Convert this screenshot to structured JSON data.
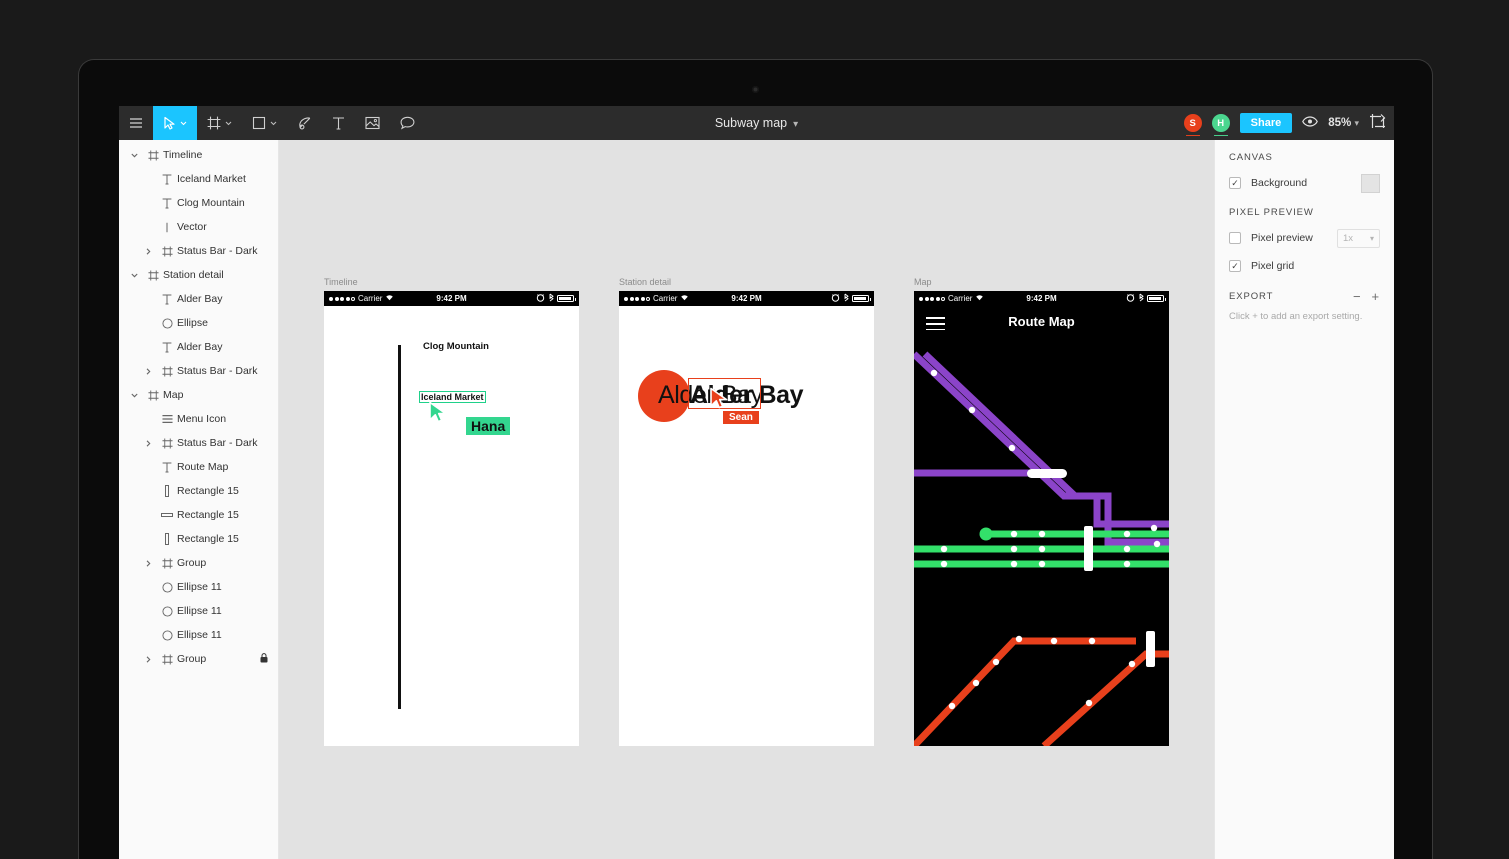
{
  "app": {
    "file_title": "Subway map",
    "zoom_level": "85%",
    "share_label": "Share",
    "avatars": [
      {
        "initial": "S",
        "color": "#e8401c"
      },
      {
        "initial": "H",
        "color": "#4bd68f"
      }
    ],
    "toolbar_icons": [
      "menu-icon",
      "move-tool-icon",
      "frame-tool-icon",
      "shape-tool-icon",
      "pen-tool-icon",
      "text-tool-icon",
      "image-tool-icon",
      "comment-tool-icon"
    ],
    "accent_color": "#1bc5ff"
  },
  "layers": {
    "items": [
      {
        "label": "Timeline",
        "icon": "frame-icon",
        "indent": 0,
        "disclosure": "down",
        "locked": false
      },
      {
        "label": "Iceland Market",
        "icon": "text-icon",
        "indent": 1,
        "disclosure": "none",
        "locked": false
      },
      {
        "label": "Clog Mountain",
        "icon": "text-icon",
        "indent": 1,
        "disclosure": "none",
        "locked": false
      },
      {
        "label": "Vector",
        "icon": "vector-icon",
        "indent": 1,
        "disclosure": "none",
        "locked": false
      },
      {
        "label": "Status Bar - Dark",
        "icon": "frame-icon",
        "indent": 1,
        "disclosure": "right",
        "locked": false
      },
      {
        "label": "Station detail",
        "icon": "frame-icon",
        "indent": 0,
        "disclosure": "down",
        "locked": false
      },
      {
        "label": "Alder Bay",
        "icon": "text-icon",
        "indent": 1,
        "disclosure": "none",
        "locked": false
      },
      {
        "label": "Ellipse",
        "icon": "ellipse-icon",
        "indent": 1,
        "disclosure": "none",
        "locked": false
      },
      {
        "label": "Alder Bay",
        "icon": "text-icon",
        "indent": 1,
        "disclosure": "none",
        "locked": false
      },
      {
        "label": "Status Bar - Dark",
        "icon": "frame-icon",
        "indent": 1,
        "disclosure": "right",
        "locked": false
      },
      {
        "label": "Map",
        "icon": "frame-icon",
        "indent": 0,
        "disclosure": "down",
        "locked": false
      },
      {
        "label": "Menu Icon",
        "icon": "lines-icon",
        "indent": 1,
        "disclosure": "none",
        "locked": false
      },
      {
        "label": "Status Bar - Dark",
        "icon": "frame-icon",
        "indent": 1,
        "disclosure": "right",
        "locked": false
      },
      {
        "label": "Route Map",
        "icon": "text-icon",
        "indent": 1,
        "disclosure": "none",
        "locked": false
      },
      {
        "label": "Rectangle 15",
        "icon": "vrect-icon",
        "indent": 1,
        "disclosure": "none",
        "locked": false
      },
      {
        "label": "Rectangle 15",
        "icon": "hrect-icon",
        "indent": 1,
        "disclosure": "none",
        "locked": false
      },
      {
        "label": "Rectangle 15",
        "icon": "vrect-icon",
        "indent": 1,
        "disclosure": "none",
        "locked": false
      },
      {
        "label": "Group",
        "icon": "frame-icon",
        "indent": 1,
        "disclosure": "right",
        "locked": false
      },
      {
        "label": "Ellipse 11",
        "icon": "ellipse-icon",
        "indent": 1,
        "disclosure": "none",
        "locked": false
      },
      {
        "label": "Ellipse 11",
        "icon": "ellipse-icon",
        "indent": 1,
        "disclosure": "none",
        "locked": false
      },
      {
        "label": "Ellipse 11",
        "icon": "ellipse-icon",
        "indent": 1,
        "disclosure": "none",
        "locked": false
      },
      {
        "label": "Group",
        "icon": "frame-icon",
        "indent": 1,
        "disclosure": "right",
        "locked": true
      }
    ]
  },
  "inspector": {
    "canvas": {
      "title": "Canvas",
      "background_label": "Background",
      "background_checked": true,
      "background_color": "#e4e4e4"
    },
    "pixel_preview": {
      "title": "Pixel Preview",
      "preview_label": "Pixel preview",
      "preview_checked": false,
      "scale_value": "1x",
      "grid_label": "Pixel grid",
      "grid_checked": true
    },
    "export": {
      "title": "Export",
      "minus_label": "−",
      "plus_label": "+",
      "hint": "Click + to add an export setting."
    },
    "check_glyph": "✓"
  },
  "frames": [
    {
      "name": "Timeline",
      "statusbar": {
        "carrier": "Carrier",
        "time": "9:42 PM"
      },
      "texts": {
        "clog_mountain": "Clog Mountain",
        "iceland_market": "Iceland Market",
        "hana_label": "Hana"
      },
      "cursor": {
        "name": "Hana",
        "color": "#33d68f"
      }
    },
    {
      "name": "Station detail",
      "statusbar": {
        "carrier": "Carrier",
        "time": "9:42 PM"
      },
      "texts": {
        "alder_bay_base": "Alder Bay",
        "alder_bay_selected": "Alder Bay"
      },
      "cursor": {
        "name": "Sean",
        "color": "#e8401c"
      }
    },
    {
      "name": "Map",
      "statusbar": {
        "carrier": "Carrier",
        "time": "9:42 PM"
      },
      "texts": {
        "route_map": "Route Map"
      },
      "line_colors": {
        "purple": "#8b44c9",
        "green": "#33e06a",
        "orange": "#e8401c"
      }
    }
  ]
}
